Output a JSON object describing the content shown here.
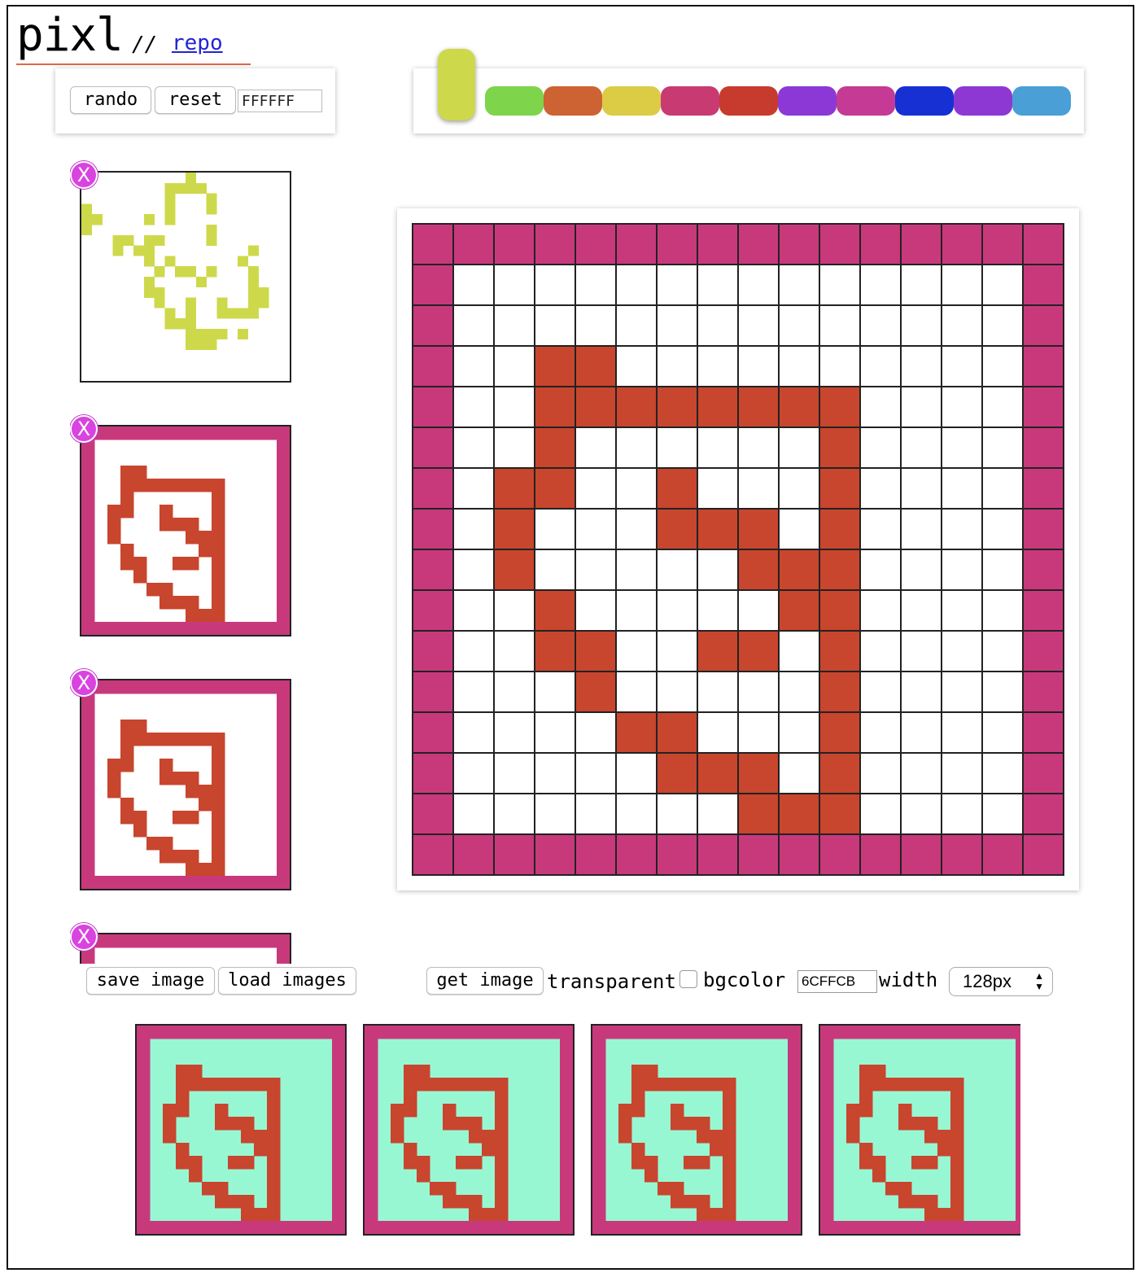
{
  "app": {
    "logo": "pixl",
    "separator": "//",
    "repo_link": "repo"
  },
  "controls": {
    "rando_label": "rando",
    "reset_label": "reset",
    "hex_value": "FFFFFF"
  },
  "palette": {
    "current": "#cdd94a",
    "swatches": [
      "#7ed44b",
      "#cd6233",
      "#dccb45",
      "#c83a72",
      "#c73a2e",
      "#8c38d6",
      "#c43a94",
      "#1730d4",
      "#8e38d4",
      "#4a9fd6"
    ]
  },
  "grid": {
    "size": 16,
    "border_color": "#c8397c",
    "fill_color": "#c8452e",
    "empty_color": "#ffffff",
    "rows": [
      "BBBBBBBBBBBBBBBB",
      "B..............B",
      "B..............B",
      "B..XX..........B",
      "B..XXXXXXXX....B",
      "B..X......X....B",
      "B.XX..X...X....B",
      "B.X...XXX.X....B",
      "B.X.....XXX....B",
      "B..X.....XX....B",
      "B..XX..XX.X....B",
      "B...X.....X....B",
      "B....XX...X....B",
      "B.....XXX.X....B",
      "B.......XXX....B",
      "BBBBBBBBBBBBBBBB"
    ]
  },
  "saved_images": [
    {
      "bg": "#ffffff",
      "border": "none",
      "fill": "#cdd94a"
    },
    {
      "bg": "#ffffff",
      "border": "#c8397c",
      "fill": "#c8452e"
    },
    {
      "bg": "#ffffff",
      "border": "#c8397c",
      "fill": "#c8452e"
    },
    {
      "bg": "#ffffff",
      "border": "#c8397c",
      "fill": "#c8452e"
    }
  ],
  "sketch_rows": [
    "..........X.........",
    "........XXXX........",
    "........X...X.......",
    "X.......X...X.......",
    "XX....X.X...........",
    "X...........X.......",
    "...XX.XX....X.......",
    "...X.XX.........X...",
    "......X.X......X....",
    ".......X.XX.X...X...",
    "......X....X....X...",
    "......XX........XX..",
    ".......X..X..X..XX..",
    "........X.X..XXXX...",
    "........XXX.........",
    "..........XXXX.X....",
    "..........XXX.......",
    "....................",
    "....................",
    "...................."
  ],
  "remove_label": "X",
  "bottom": {
    "save_label": "save image",
    "load_label": "load images",
    "get_label": "get image",
    "transparent_label": "transparent",
    "bgcolor_label": "bgcolor",
    "bgcolor_value": "6CFFCB",
    "width_label": "width",
    "width_value": "128px"
  },
  "outputs": {
    "count": 4,
    "bg": "#98f7d3"
  }
}
